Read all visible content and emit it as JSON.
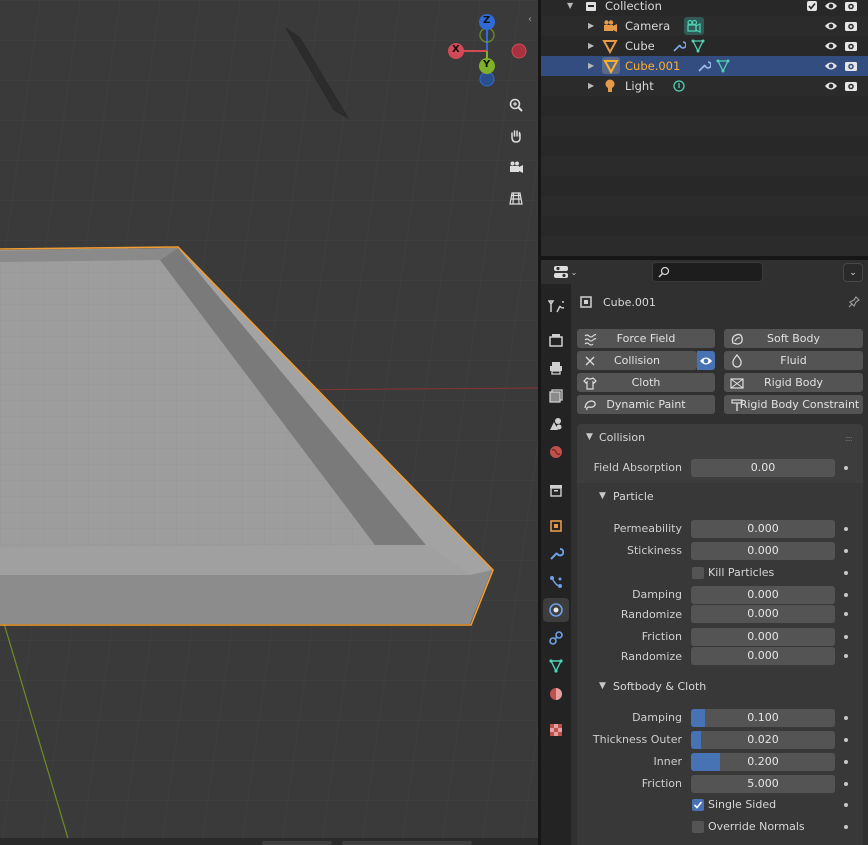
{
  "outliner": {
    "rows": [
      {
        "label": "Collection",
        "icon": "collection-icon"
      },
      {
        "label": "Camera",
        "icon": "camera-object-icon",
        "extra": "camera-data-icon"
      },
      {
        "label": "Cube",
        "icon": "mesh-object-icon",
        "extra": "modifier-wrench-icon"
      },
      {
        "label": "Cube.001",
        "icon": "mesh-object-icon",
        "extra": "modifier-wrench-icon",
        "selected": true
      },
      {
        "label": "Light",
        "icon": "light-object-icon",
        "extra": "light-data-icon"
      }
    ]
  },
  "viewport": {
    "gizmo": {
      "z": "Z",
      "y": "Y",
      "x": "X"
    },
    "colors": {
      "background": "#3a3a3a",
      "selection_outline": "#f19d33",
      "x_axis": "#a03838",
      "y_axis": "#6a8a20"
    }
  },
  "properties": {
    "object_name": "Cube.001",
    "physics_buttons": {
      "force_field": "Force Field",
      "soft_body": "Soft Body",
      "collision": "Collision",
      "fluid": "Fluid",
      "cloth": "Cloth",
      "rigid_body": "Rigid Body",
      "dynamic_paint": "Dynamic Paint",
      "rigid_body_constraint": "Rigid Body Constraint"
    },
    "collision_panel": {
      "title": "Collision",
      "field_absorption_label": "Field Absorption",
      "field_absorption": "0.00",
      "particle": {
        "title": "Particle",
        "permeability_label": "Permeability",
        "permeability": "0.000",
        "stickiness_label": "Stickiness",
        "stickiness": "0.000",
        "kill_particles_label": "Kill Particles",
        "kill_particles": false,
        "damping_label": "Damping",
        "damping": "0.000",
        "damping_randomize_label": "Randomize",
        "damping_randomize": "0.000",
        "friction_label": "Friction",
        "friction": "0.000",
        "friction_randomize_label": "Randomize",
        "friction_randomize": "0.000"
      },
      "softbody_cloth": {
        "title": "Softbody & Cloth",
        "damping_label": "Damping",
        "damping": "0.100",
        "damping_fill": 0.1,
        "thickness_outer_label": "Thickness Outer",
        "thickness_outer": "0.020",
        "thickness_outer_fill": 0.02,
        "inner_label": "Inner",
        "inner": "0.200",
        "inner_fill": 0.2,
        "friction_label": "Friction",
        "friction": "5.000",
        "single_sided_label": "Single Sided",
        "single_sided": true,
        "override_normals_label": "Override Normals",
        "override_normals": false
      }
    },
    "accent": "#4772b3"
  }
}
